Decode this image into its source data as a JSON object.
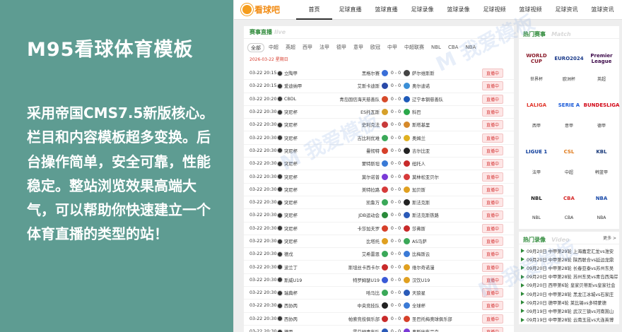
{
  "banner": {
    "title": "M95看球体育模板",
    "description": "采用帝国CMS7.5新版核心。栏目和内容模板超多变换。后台操作简单，安全可靠，性能稳定。整站浏览效果高端大气，可以帮助你快速建立一个体育直播的类型的站！"
  },
  "site": {
    "logo_text": "看球吧",
    "nav": [
      "首页",
      "足球直播",
      "篮球直播",
      "足球录像",
      "篮球录像",
      "足球视频",
      "篮球视频",
      "足球资讯",
      "篮球资讯"
    ]
  },
  "live": {
    "title": "赛事直播",
    "title_en": "live",
    "tabs": [
      "全部",
      "中超",
      "英超",
      "西甲",
      "法甲",
      "德甲",
      "意甲",
      "欧冠",
      "中甲",
      "中超联赛",
      "NBL",
      "CBA",
      "NBA"
    ],
    "date": "2026-03-22 星期日",
    "status_label": "直播中",
    "matches": [
      {
        "time": "03-22 20:15",
        "league": "立陶甲",
        "home": "黑格尔赛",
        "score": "0 - 0",
        "away": "萨尔维斯斯",
        "hc": "#3a6fd8",
        "ac": "#444"
      },
      {
        "time": "03-22 20:15",
        "league": "爱迪纳甲",
        "home": "艾斯卡迪斯",
        "score": "0 - 0",
        "away": "奥尔迪诺",
        "hc": "#2a4aa8",
        "ac": "#3b8fd6"
      },
      {
        "time": "03-22 20:20",
        "league": "CBDL",
        "home": "青岛国信海天慈善队",
        "score": "0 - 0",
        "away": "辽宁本钢慈善队",
        "hc": "#d64a2a",
        "ac": "#1e5ab8"
      },
      {
        "time": "03-22 20:30",
        "league": "突尼杯",
        "home": "ES托瓦斯",
        "score": "0 - 0",
        "away": "科巴",
        "hc": "#d6a02a",
        "ac": "#2aa84a"
      },
      {
        "time": "03-22 20:30",
        "league": "突尼杯",
        "home": "史利克法",
        "score": "0 - 0",
        "away": "斯塔基里",
        "hc": "#c83a3a",
        "ac": "#d68a2a"
      },
      {
        "time": "03-22 20:30",
        "league": "突尼杯",
        "home": "吉比利优难",
        "score": "0 - 0",
        "away": "奥姆兰",
        "hc": "#3aa858",
        "ac": "#e0b020"
      },
      {
        "time": "03-22 20:30",
        "league": "突尼杯",
        "home": "曼彻特",
        "score": "0 - 0",
        "away": "吉尔比亚",
        "hc": "#d6402a",
        "ac": "#222"
      },
      {
        "time": "03-22 20:30",
        "league": "突尼杯",
        "home": "蒙特斯坦",
        "score": "0 - 0",
        "away": "纽托人",
        "hc": "#3a7ad6",
        "ac": "#c82a2a"
      },
      {
        "time": "03-22 20:30",
        "league": "突尼杯",
        "home": "莫尔诺普",
        "score": "0 - 0",
        "away": "莫林松亚贝尔",
        "hc": "#7a3ad6",
        "ac": "#d63a3a"
      },
      {
        "time": "03-22 20:30",
        "league": "突尼杯",
        "home": "美特拉路",
        "score": "0 - 0",
        "away": "加贝斯",
        "hc": "#d63a3a",
        "ac": "#e0a020"
      },
      {
        "time": "03-22 20:30",
        "league": "突尼杯",
        "home": "凯鲁万",
        "score": "0 - 0",
        "away": "斯法克斯",
        "hc": "#3aa858",
        "ac": "#222"
      },
      {
        "time": "03-22 20:30",
        "league": "突尼杯",
        "home": "JDB运动会",
        "score": "0 - 0",
        "away": "斯法克斯铁路",
        "hc": "#2a8a3a",
        "ac": "#2a5ab8"
      },
      {
        "time": "03-22 20:30",
        "league": "突尼杯",
        "home": "卡莎加夫罗",
        "score": "0 - 0",
        "away": "莎弗斯",
        "hc": "#d6402a",
        "ac": "#c82a2a"
      },
      {
        "time": "03-22 20:30",
        "league": "突尼杯",
        "home": "比塔托",
        "score": "0 - 0",
        "away": "AS马萨",
        "hc": "#e0a020",
        "ac": "#3aa858"
      },
      {
        "time": "03-22 20:30",
        "league": "德戊",
        "home": "艾希雷恩",
        "score": "0 - 0",
        "away": "比梅斯云",
        "hc": "#3aa858",
        "ac": "#3a7ad6"
      },
      {
        "time": "03-22 20:30",
        "league": "波兰丁",
        "home": "斯坦丝卡西卡尔",
        "score": "0 - 0",
        "away": "维尔奇诺漫",
        "hc": "#c82a2a",
        "ac": "#e0a020"
      },
      {
        "time": "03-22 20:30",
        "league": "斯威U19",
        "home": "特罗姆瑟U19",
        "score": "0 - 0",
        "away": "汉饮U19",
        "hc": "#3a5ad6",
        "ac": "#e0a020"
      },
      {
        "time": "03-22 20:30",
        "league": "瑞典杯",
        "home": "哈马比",
        "score": "0 - 0",
        "away": "天狼星",
        "hc": "#3aa858",
        "ac": "#2a5ab8"
      },
      {
        "time": "03-22 20:30",
        "league": "西协丙",
        "home": "中央竞技队",
        "score": "0 - 0",
        "away": "全球杯",
        "hc": "#222",
        "ac": "#3a7ad6"
      },
      {
        "time": "03-22 20:30",
        "league": "西协丙",
        "home": "帕索竞技俱乐部",
        "score": "0 - 0",
        "away": "圣巴托梅奥球俱乐部",
        "hc": "#c82a2a",
        "ac": "#d6402a"
      },
      {
        "time": "03-22 20:30",
        "league": "德丙",
        "home": "霍芬姆青年队",
        "score": "0 - 0",
        "away": "奥斯纳布吕克",
        "hc": "#2a5ab8",
        "ac": "#7a3ad6"
      }
    ]
  },
  "hot_events": {
    "title": "热门赛事",
    "title_en": "Match",
    "items": [
      {
        "logo": "WORLD CUP",
        "label": "世界杯",
        "color": "#8a1a2a"
      },
      {
        "logo": "EURO2024",
        "label": "欧洲杯",
        "color": "#1a3a8a"
      },
      {
        "logo": "Premier League",
        "label": "英超",
        "color": "#3d0a4a"
      },
      {
        "logo": "LALIGA",
        "label": "西甲",
        "color": "#e0342a"
      },
      {
        "logo": "SERIE A",
        "label": "意甲",
        "color": "#1a5ad8"
      },
      {
        "logo": "BUNDESLIGA",
        "label": "德甲",
        "color": "#d20515"
      },
      {
        "logo": "LIGUE 1",
        "label": "法甲",
        "color": "#0a3a9a"
      },
      {
        "logo": "CSL",
        "label": "中超",
        "color": "#e07a1a"
      },
      {
        "logo": "KBL",
        "label": "韩篮甲",
        "color": "#1a3a7a"
      },
      {
        "logo": "NBL",
        "label": "NBL",
        "color": "#222"
      },
      {
        "logo": "CBA",
        "label": "CBA",
        "color": "#d62a2a"
      },
      {
        "logo": "NBA",
        "label": "NBA",
        "color": "#1a4aa8"
      }
    ]
  },
  "hot_videos": {
    "title": "热门录像",
    "title_en": "Video",
    "more": "更多 >",
    "items": [
      {
        "date": "09月20日",
        "text": "中甲第29轮 上海嘉定汇龙vs淮安"
      },
      {
        "date": "09月20日",
        "text": "中甲第28轮 陕西联合vs延边龙鼎"
      },
      {
        "date": "09月20日",
        "text": "中甲第28轮 长春亚泰vs苏州东吴"
      },
      {
        "date": "09月20日",
        "text": "中甲第28轮 苏州东吴vs青岛西海岸"
      },
      {
        "date": "09月20日",
        "text": "西甲第6轮 皇家贝蒂斯vs皇家社会"
      },
      {
        "date": "09月20日",
        "text": "中甲第28轮 黑龙江冰城vs石家庄"
      },
      {
        "date": "09月20日",
        "text": "德甲第4轮 莱比锡vs多特蒙德"
      },
      {
        "date": "09月19日",
        "text": "中甲第28轮 武汉三镇vs河南嵩山"
      },
      {
        "date": "09月19日",
        "text": "中甲第28轮 云南玉昆vs大连英博"
      }
    ]
  },
  "watermark": "M 我爱模板"
}
